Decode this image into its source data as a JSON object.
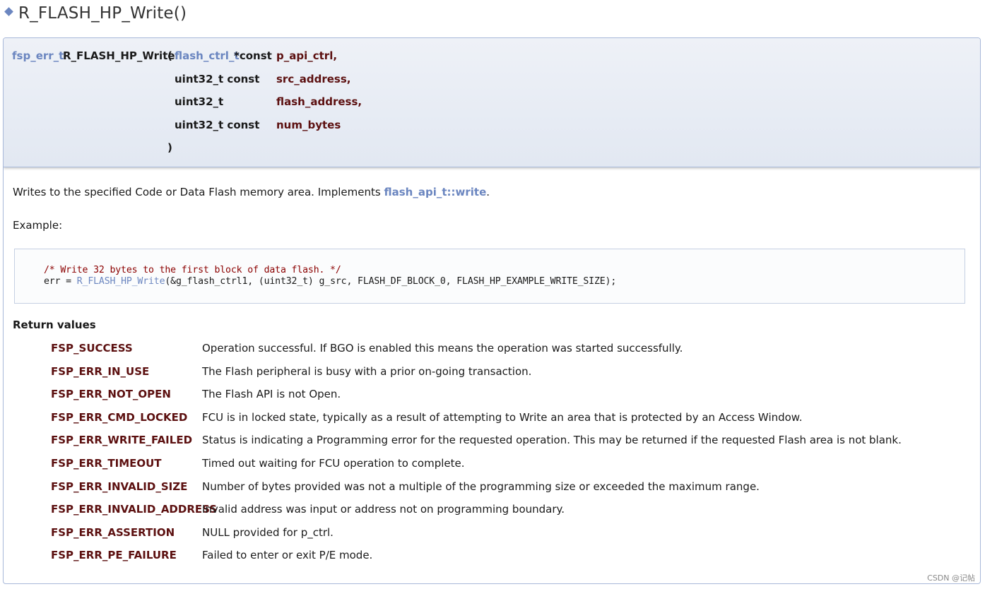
{
  "title": "R_FLASH_HP_Write()",
  "prototype": {
    "return_type": "fsp_err_t",
    "function_name": "R_FLASH_HP_Write",
    "open_paren": "(",
    "close_paren": ")",
    "params": [
      {
        "type_link": "flash_ctrl_t",
        "type_rest": " *const",
        "name": "p_api_ctrl,"
      },
      {
        "type": "uint32_t const",
        "name": "src_address,"
      },
      {
        "type": "uint32_t",
        "name": "flash_address,"
      },
      {
        "type": "uint32_t const",
        "name": "num_bytes"
      }
    ]
  },
  "description": {
    "text": "Writes to the specified Code or Data Flash memory area. Implements ",
    "link": "flash_api_t::write",
    "suffix": "."
  },
  "example_label": "Example:",
  "code": {
    "comment": "/* Write 32 bytes to the first block of data flash. */",
    "line2_prefix": "err = ",
    "line2_link": "R_FLASH_HP_Write",
    "line2_rest": "(&g_flash_ctrl1, (uint32_t) g_src, FLASH_DF_BLOCK_0, FLASH_HP_EXAMPLE_WRITE_SIZE);"
  },
  "return_values": {
    "heading": "Return values",
    "items": [
      {
        "code": "FSP_SUCCESS",
        "desc": "Operation successful. If BGO is enabled this means the operation was started successfully."
      },
      {
        "code": "FSP_ERR_IN_USE",
        "desc": "The Flash peripheral is busy with a prior on-going transaction."
      },
      {
        "code": "FSP_ERR_NOT_OPEN",
        "desc": "The Flash API is not Open."
      },
      {
        "code": "FSP_ERR_CMD_LOCKED",
        "desc": "FCU is in locked state, typically as a result of attempting to Write an area that is protected by an Access Window."
      },
      {
        "code": "FSP_ERR_WRITE_FAILED",
        "desc": "Status is indicating a Programming error for the requested operation. This may be returned if the requested Flash area is not blank."
      },
      {
        "code": "FSP_ERR_TIMEOUT",
        "desc": "Timed out waiting for FCU operation to complete."
      },
      {
        "code": "FSP_ERR_INVALID_SIZE",
        "desc": "Number of bytes provided was not a multiple of the programming size or exceeded the maximum range."
      },
      {
        "code": "FSP_ERR_INVALID_ADDRESS",
        "desc": "Invalid address was input or address not on programming boundary."
      },
      {
        "code": "FSP_ERR_ASSERTION",
        "desc": "NULL provided for p_ctrl."
      },
      {
        "code": "FSP_ERR_PE_FAILURE",
        "desc": "Failed to enter or exit P/E mode."
      }
    ]
  },
  "watermark": "CSDN @记帖",
  "colors": {
    "link": "#6b86c0",
    "param_name": "#5c1010",
    "comment": "#8b0000",
    "header_bg": "#e2e8f2",
    "border": "#a8b8d9"
  }
}
